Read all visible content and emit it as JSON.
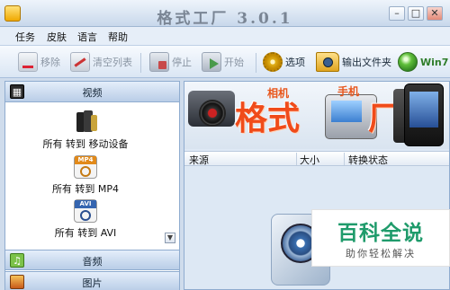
{
  "window": {
    "title": "格式工厂 3.0.1",
    "controls": {
      "minimize": "–",
      "maximize": "□",
      "close": "✕"
    }
  },
  "menu": [
    "任务",
    "皮肤",
    "语言",
    "帮助"
  ],
  "toolbar": {
    "remove": "移除",
    "clear_list": "清空列表",
    "stop": "停止",
    "start": "开始",
    "options": "选项",
    "output_folder": "输出文件夹",
    "win7": "Win7"
  },
  "sidebar": {
    "categories": {
      "video": "视频",
      "audio": "音频",
      "image": "图片"
    },
    "video_items": [
      {
        "label": "所有 转到 移动设备",
        "icon": "mobile-devices-icon"
      },
      {
        "label": "所有 转到 MP4",
        "icon": "mp4-icon",
        "badge": "MP4"
      },
      {
        "label": "所有 转到 AVI",
        "icon": "avi-icon",
        "badge": "AVI"
      }
    ]
  },
  "banner": {
    "big_text_1": "格式",
    "big_text_2": "厂",
    "tag_camera": "相机",
    "tag_phone": "手机"
  },
  "table": {
    "columns": [
      "来源",
      "大小",
      "转换状态"
    ]
  },
  "watermark": {
    "main": "百科全说",
    "sub": "助你轻松解决"
  },
  "colors": {
    "accent": "#f04b1a",
    "watermark_green": "#1f9b6b"
  }
}
